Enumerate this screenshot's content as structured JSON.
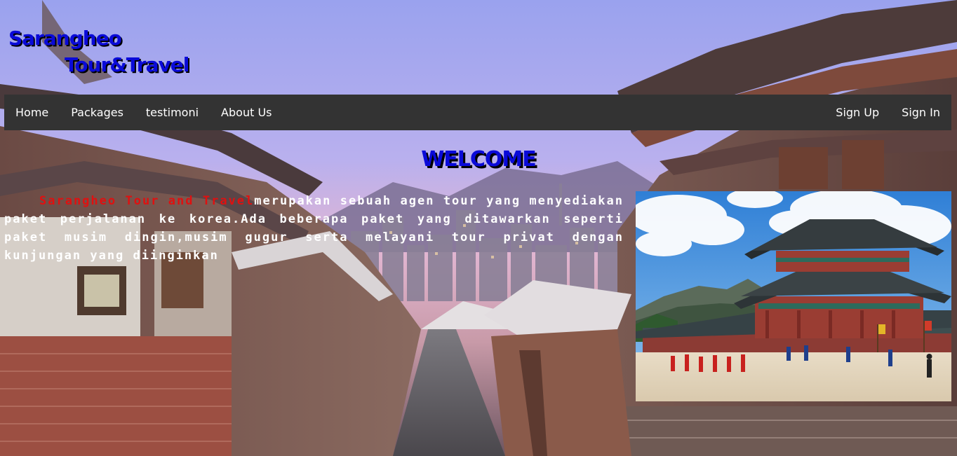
{
  "logo": {
    "line1": "Sarangheo",
    "line2": "Tour&Travel"
  },
  "nav": {
    "left": [
      "Home",
      "Packages",
      "testimoni",
      "About Us"
    ],
    "right": [
      "Sign Up",
      "Sign In"
    ]
  },
  "welcome": {
    "title": "WELCOME"
  },
  "intro": {
    "brand": "Sarangheo Tour and Travel",
    "text": "merupakan sebuah agen tour yang menyediakan paket perjalanan ke korea.Ada beberapa paket yang ditawarkan seperti paket musim dingin,musim gugur serta melayani tour privat dengan kunjungan yang diinginkan"
  },
  "colors": {
    "logo": "#0a0ad8",
    "navbar": "#333333",
    "nav_text": "#ffffff",
    "brand_text": "#e01010",
    "body_text": "#ffffff"
  },
  "images": {
    "background": "hanok-village-street-background",
    "feature": "gyeongbokgung-palace-photo"
  }
}
